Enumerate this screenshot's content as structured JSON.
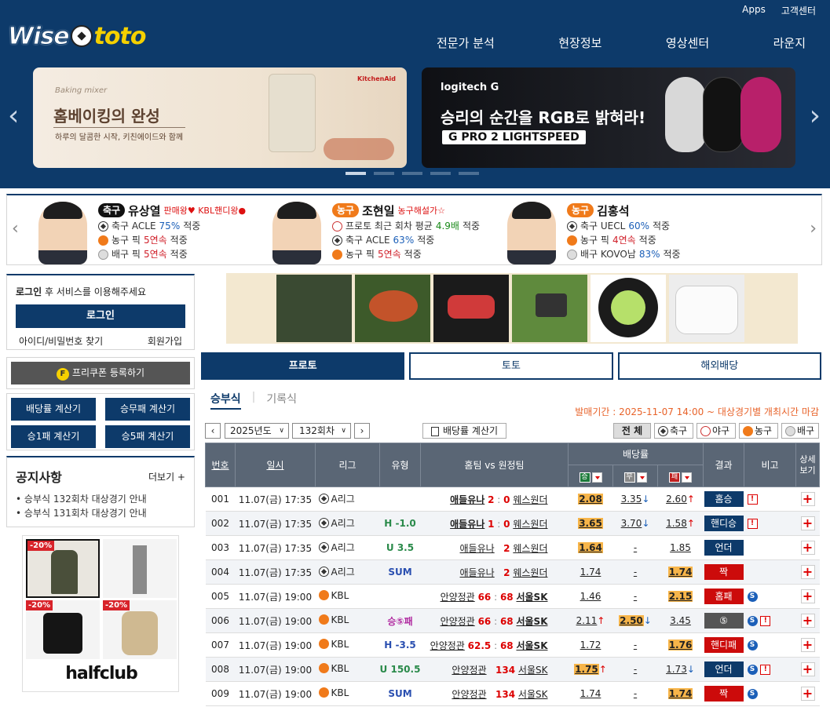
{
  "header": {
    "logo_left": "Wise",
    "logo_right": "toto",
    "top_links": [
      "Apps",
      "고객센터"
    ],
    "nav": [
      "전문가 분석",
      "현장정보",
      "영상센터",
      "라운지"
    ],
    "banner1": {
      "script": "Baking mixer",
      "title": "홈베이킹의 완성",
      "sub": "하루의 달콤한 시작, 키친에이드와 함께",
      "brand": "KitchenAid"
    },
    "banner2": {
      "brand": "logitech G",
      "title": "승리의 순간을 RGB로 밝혀라!",
      "tag": "G PRO 2 LIGHTSPEED"
    },
    "slide_count": 5,
    "slide_active": 0
  },
  "experts": [
    {
      "sport": "축구",
      "sport_color": "#111111",
      "name": "유상열",
      "badge": "판매왕♥ KBL핸디왕●",
      "lines": [
        {
          "icon": "soccer",
          "pre": "축구 ACLE",
          "val": "75%",
          "val_class": "blue",
          "post": "적중"
        },
        {
          "icon": "basketball",
          "pre": "농구 픽",
          "val": "5연속",
          "val_class": "red",
          "post": "적중"
        },
        {
          "icon": "volleyball",
          "pre": "배구 픽",
          "val": "5연속",
          "val_class": "red",
          "post": "적중"
        }
      ]
    },
    {
      "sport": "농구",
      "sport_color": "#f07a1a",
      "name": "조현일",
      "badge": "농구해설가☆",
      "lines": [
        {
          "icon": "proto",
          "pre": "프로토 최근 회차 평균",
          "val": "4.9배",
          "val_class": "grn",
          "post": "적중"
        },
        {
          "icon": "soccer",
          "pre": "축구 ACLE",
          "val": "63%",
          "val_class": "blue",
          "post": "적중"
        },
        {
          "icon": "basketball",
          "pre": "농구 픽",
          "val": "5연속",
          "val_class": "red",
          "post": "적중"
        }
      ]
    },
    {
      "sport": "농구",
      "sport_color": "#f07a1a",
      "name": "김홍석",
      "badge": "",
      "lines": [
        {
          "icon": "soccer",
          "pre": "축구 UECL",
          "val": "60%",
          "val_class": "blue",
          "post": "적중"
        },
        {
          "icon": "basketball",
          "pre": "농구 픽",
          "val": "4연속",
          "val_class": "red",
          "post": "적중"
        },
        {
          "icon": "volleyball",
          "pre": "배구 KOVO남",
          "val": "83%",
          "val_class": "blue",
          "post": "적중"
        }
      ]
    }
  ],
  "login": {
    "msg_bold": "로그인",
    "msg_rest": " 후 서비스를 이용해주세요",
    "button": "로그인",
    "find": "아이디/비밀번호 찾기",
    "join": "회원가입"
  },
  "coupon": {
    "icon": "F",
    "label": "프리쿠폰 등록하기"
  },
  "calcs": [
    "배당률 계산기",
    "승무패 계산기",
    "승1패 계산기",
    "승5패 계산기"
  ],
  "notice": {
    "title": "공지사항",
    "more": "더보기 +",
    "items": [
      "승부식 132회차 대상경기 안내",
      "승부식 131회차 대상경기 안내"
    ]
  },
  "ad": {
    "discounts": [
      "-20%",
      "-20%",
      "-20%"
    ],
    "logo": "halfclub"
  },
  "main_tabs": [
    "프로토",
    "토토",
    "해외배당"
  ],
  "sub_tabs": [
    "승부식",
    "기록식"
  ],
  "period": "발매기간 : 2025-11-07 14:00 ~ 대상경기별 개최시간 마감",
  "controls": {
    "year": "2025년도",
    "round": "132회차",
    "calc": "배당률 계산기",
    "filters": [
      "전 체",
      "축구",
      "야구",
      "농구",
      "배구"
    ]
  },
  "table": {
    "headers": [
      "번호",
      "일시",
      "리그",
      "유형",
      "홈팀 vs 원정팀",
      "배당률",
      "결과",
      "비고",
      "상세보기"
    ],
    "odd_headers": [
      "승",
      "무",
      "패"
    ],
    "rows": [
      {
        "no": "001",
        "date": "11.07(금) 17:35",
        "sport": "soccer",
        "league": "A리그",
        "type": "",
        "type_class": "",
        "home": "애들유나",
        "hs": "2",
        "as": "0",
        "away": "웨스원더",
        "hb": true,
        "ab": false,
        "w": "2.08",
        "w_hl": true,
        "w_dir": "",
        "d": "3.35",
        "d_hl": false,
        "d_dir": "dn",
        "l": "2.60",
        "l_hl": false,
        "l_dir": "up",
        "res": "홈승",
        "res_class": "nb",
        "note": "x"
      },
      {
        "no": "002",
        "date": "11.07(금) 17:35",
        "sport": "soccer",
        "league": "A리그",
        "type": "H -1.0",
        "type_class": "g",
        "home": "애들유나",
        "hs": "1",
        "as": "0",
        "away": "웨스원더",
        "hb": true,
        "ab": false,
        "w": "3.65",
        "w_hl": true,
        "w_dir": "",
        "d": "3.70",
        "d_hl": false,
        "d_dir": "dn",
        "l": "1.58",
        "l_hl": false,
        "l_dir": "up",
        "res": "핸디승",
        "res_class": "nb",
        "note": "x"
      },
      {
        "no": "003",
        "date": "11.07(금) 17:35",
        "sport": "soccer",
        "league": "A리그",
        "type": "U 3.5",
        "type_class": "g",
        "home": "애들유나",
        "hs": "",
        "as": "2",
        "away": "웨스원더",
        "hb": false,
        "ab": false,
        "w": "1.64",
        "w_hl": true,
        "w_dir": "",
        "d": "-",
        "d_hl": false,
        "d_dir": "",
        "l": "1.85",
        "l_hl": false,
        "l_dir": "",
        "res": "언더",
        "res_class": "nb",
        "note": ""
      },
      {
        "no": "004",
        "date": "11.07(금) 17:35",
        "sport": "soccer",
        "league": "A리그",
        "type": "SUM",
        "type_class": "b",
        "home": "애들유나",
        "hs": "",
        "as": "2",
        "away": "웨스원더",
        "hb": false,
        "ab": false,
        "w": "1.74",
        "w_hl": false,
        "w_dir": "",
        "d": "-",
        "d_hl": false,
        "d_dir": "",
        "l": "1.74",
        "l_hl": true,
        "l_dir": "",
        "res": "짝",
        "res_class": "rd",
        "note": ""
      },
      {
        "no": "005",
        "date": "11.07(금) 19:00",
        "sport": "basketball",
        "league": "KBL",
        "type": "",
        "type_class": "",
        "home": "안양정관",
        "hs": "66",
        "as": "68",
        "away": "서울SK",
        "hb": false,
        "ab": true,
        "w": "1.46",
        "w_hl": false,
        "w_dir": "",
        "d": "-",
        "d_hl": false,
        "d_dir": "",
        "l": "2.15",
        "l_hl": true,
        "l_dir": "",
        "res": "홈패",
        "res_class": "rd",
        "note": "s"
      },
      {
        "no": "006",
        "date": "11.07(금) 19:00",
        "sport": "basketball",
        "league": "KBL",
        "type": "승⑤패",
        "type_class": "p",
        "home": "안양정관",
        "hs": "66",
        "as": "68",
        "away": "서울SK",
        "hb": false,
        "ab": true,
        "w": "2.11",
        "w_hl": false,
        "w_dir": "up",
        "d": "2.50",
        "d_hl": true,
        "d_dir": "dn",
        "l": "3.45",
        "l_hl": false,
        "l_dir": "",
        "res": "⑤",
        "res_class": "gy",
        "note": "sx"
      },
      {
        "no": "007",
        "date": "11.07(금) 19:00",
        "sport": "basketball",
        "league": "KBL",
        "type": "H -3.5",
        "type_class": "b",
        "home": "안양정관",
        "hs": "62.5",
        "as": "68",
        "away": "서울SK",
        "hb": false,
        "ab": true,
        "w": "1.72",
        "w_hl": false,
        "w_dir": "",
        "d": "-",
        "d_hl": false,
        "d_dir": "",
        "l": "1.76",
        "l_hl": true,
        "l_dir": "",
        "res": "핸디패",
        "res_class": "rd",
        "note": "s"
      },
      {
        "no": "008",
        "date": "11.07(금) 19:00",
        "sport": "basketball",
        "league": "KBL",
        "type": "U 150.5",
        "type_class": "g",
        "home": "안양정관",
        "hs": "",
        "as": "134",
        "away": "서울SK",
        "hb": false,
        "ab": false,
        "w": "1.75",
        "w_hl": true,
        "w_dir": "up",
        "d": "-",
        "d_hl": false,
        "d_dir": "",
        "l": "1.73",
        "l_hl": false,
        "l_dir": "dn",
        "res": "언더",
        "res_class": "nb",
        "note": "sx"
      },
      {
        "no": "009",
        "date": "11.07(금) 19:00",
        "sport": "basketball",
        "league": "KBL",
        "type": "SUM",
        "type_class": "b",
        "home": "안양정관",
        "hs": "",
        "as": "134",
        "away": "서울SK",
        "hb": false,
        "ab": false,
        "w": "1.74",
        "w_hl": false,
        "w_dir": "",
        "d": "-",
        "d_hl": false,
        "d_dir": "",
        "l": "1.74",
        "l_hl": true,
        "l_dir": "",
        "res": "짝",
        "res_class": "rd",
        "note": "s"
      }
    ]
  }
}
